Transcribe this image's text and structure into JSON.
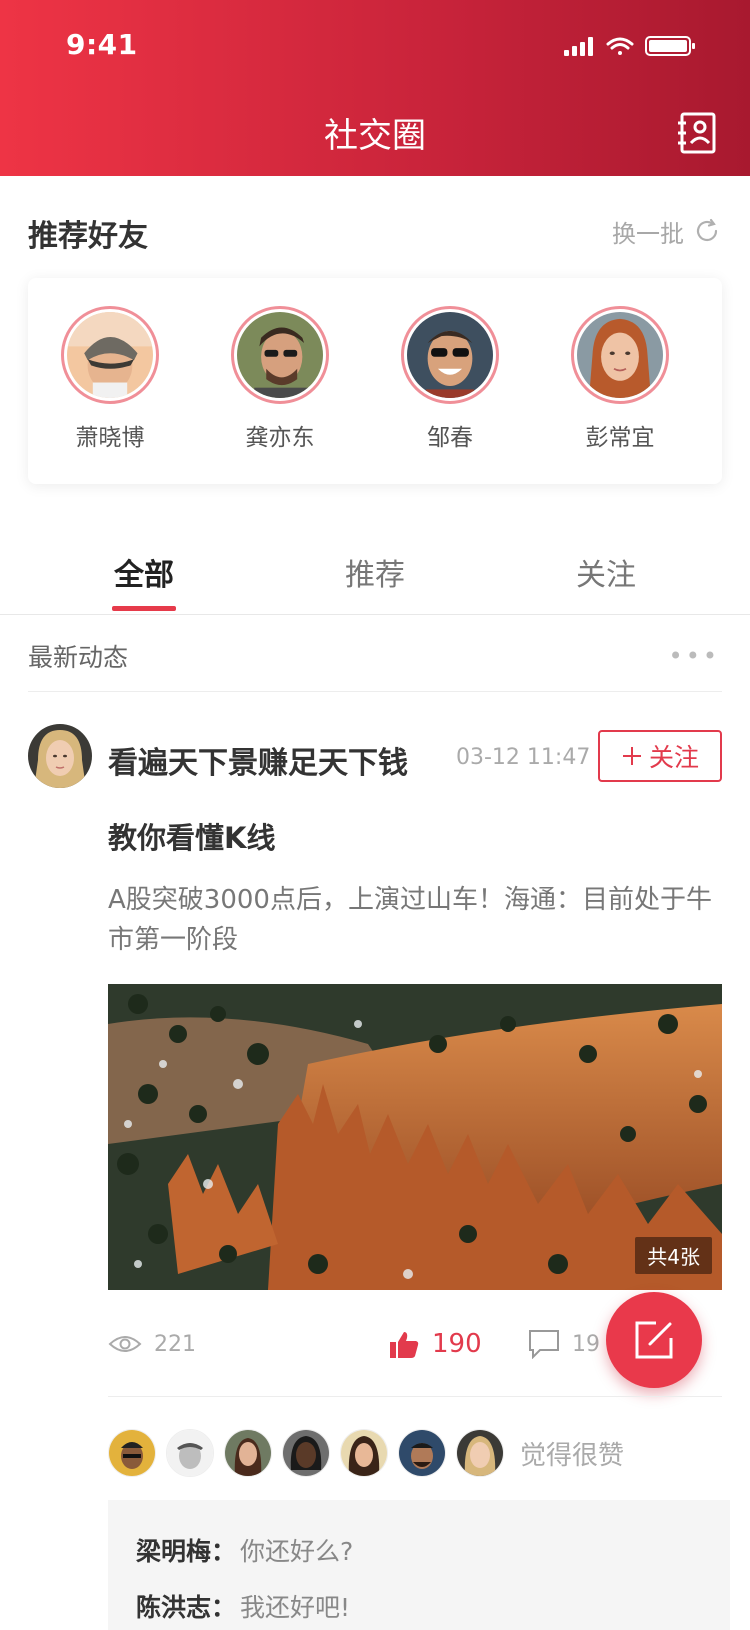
{
  "status_bar": {
    "time": "9:41"
  },
  "header": {
    "title": "社交圈"
  },
  "recommended": {
    "title": "推荐好友",
    "refresh_label": "换一批",
    "friends": [
      {
        "name": "萧晓博"
      },
      {
        "name": "龚亦东"
      },
      {
        "name": "邹春"
      },
      {
        "name": "彭常宜"
      }
    ]
  },
  "tabs": [
    {
      "label": "全部",
      "active": true
    },
    {
      "label": "推荐",
      "active": false
    },
    {
      "label": "关注",
      "active": false
    }
  ],
  "feed": {
    "title": "最新动态",
    "post": {
      "author": "看遍天下景赚足天下钱",
      "time": "03-12 11:47",
      "follow_label": "关注",
      "headline": "教你看懂K线",
      "body": "A股突破3000点后，上演过山车！海通：目前处于牛市第一阶段",
      "image_count": "共4张",
      "views": "221",
      "likes": "190",
      "comments_count": "19",
      "likers_text": "觉得很赞",
      "comments": [
        {
          "author": "梁明梅：",
          "text": "你还好么?"
        },
        {
          "author": "陈洪志：",
          "text": "我还好吧!"
        }
      ]
    }
  },
  "colors": {
    "accent": "#e23a4c",
    "header_start": "#ee3445",
    "header_end": "#a8192f"
  }
}
